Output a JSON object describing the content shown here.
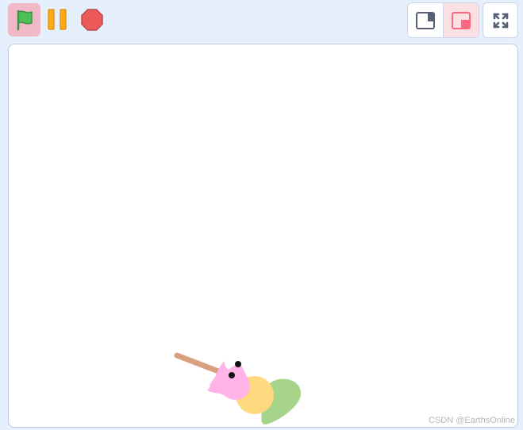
{
  "toolbar": {
    "green_flag_icon": "green-flag",
    "pause_icon": "pause",
    "stop_icon": "stop-sign",
    "small_stage_icon": "small-stage-layout",
    "large_stage_icon": "large-stage-layout",
    "fullscreen_icon": "fullscreen-expand"
  },
  "stage": {
    "sprite": "dango-skewer"
  },
  "watermark": {
    "text": "CSDN @EarthsOnline"
  },
  "colors": {
    "background": "#e6f0fc",
    "flag_active": "#f1b8c7",
    "flag_green": "#4cbf56",
    "pause_orange": "#ffab19",
    "stop_red": "#ec5959",
    "view_active": "#fde0e3",
    "accent_red": "#ff6680",
    "dango_pink": "#ffb3e6",
    "dango_yellow": "#ffd980",
    "dango_green": "#a6d48a",
    "stick": "#d9a080"
  }
}
